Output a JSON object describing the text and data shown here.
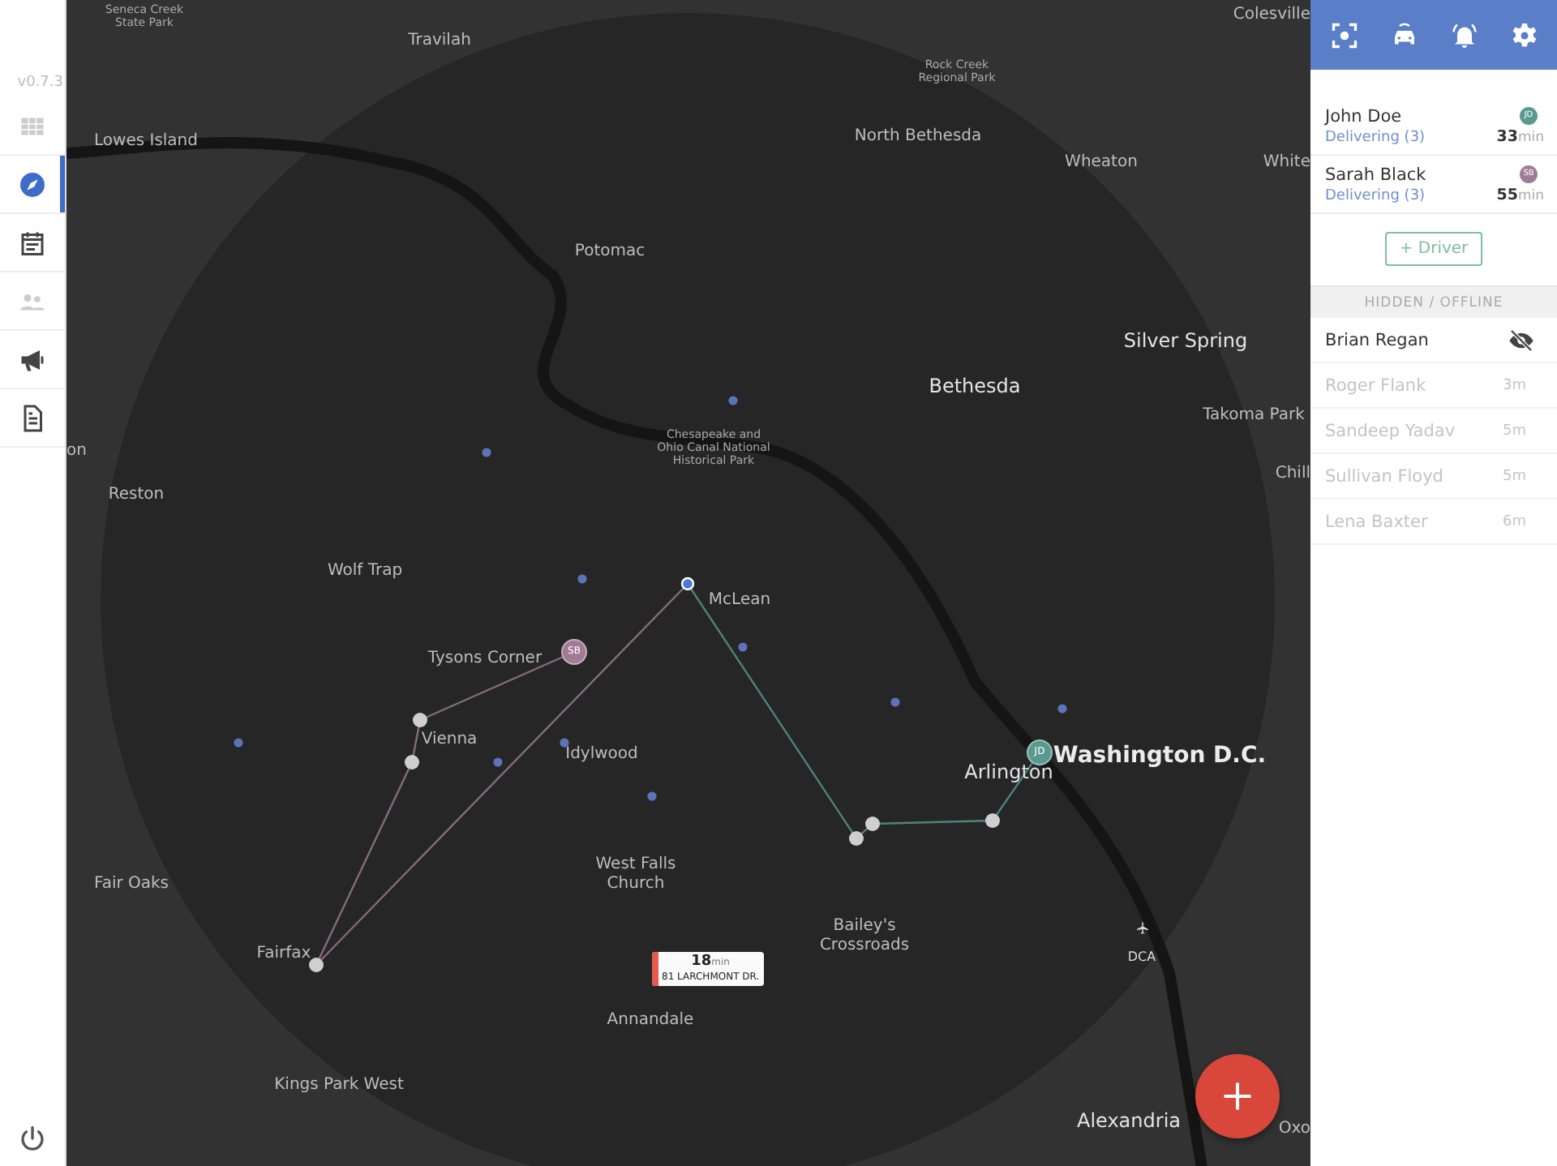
{
  "sidebar": {
    "version": "v0.7.3",
    "items": [
      {
        "selected": false,
        "disabled": true
      },
      {
        "selected": true,
        "disabled": false
      },
      {
        "selected": false,
        "disabled": false
      },
      {
        "selected": false,
        "disabled": true
      },
      {
        "selected": false,
        "disabled": false
      },
      {
        "selected": false,
        "disabled": false
      }
    ]
  },
  "map": {
    "labels": [
      {
        "text": "Seneca Creek\nState Park",
        "kind": "park"
      },
      {
        "text": "Travilah",
        "kind": "minor"
      },
      {
        "text": "Lowes Island",
        "kind": "minor"
      },
      {
        "text": "Potomac",
        "kind": "minor"
      },
      {
        "text": "on",
        "kind": "minor"
      },
      {
        "text": "Reston",
        "kind": "minor"
      },
      {
        "text": "Wolf Trap",
        "kind": "minor"
      },
      {
        "text": "Rock Creek\nRegional Park",
        "kind": "park"
      },
      {
        "text": "North Bethesda",
        "kind": "minor"
      },
      {
        "text": "Wheaton",
        "kind": "minor"
      },
      {
        "text": "Colesville",
        "kind": "minor"
      },
      {
        "text": "White",
        "kind": "minor"
      },
      {
        "text": "Silver Spring",
        "kind": "major"
      },
      {
        "text": "Bethesda",
        "kind": "major"
      },
      {
        "text": "Takoma Park",
        "kind": "minor"
      },
      {
        "text": "Chill",
        "kind": "minor"
      },
      {
        "text": "Chesapeake and\nOhio Canal National\nHistorical Park",
        "kind": "park"
      },
      {
        "text": "McLean",
        "kind": "minor"
      },
      {
        "text": "Tysons Corner",
        "kind": "minor"
      },
      {
        "text": "Vienna",
        "kind": "minor"
      },
      {
        "text": "Idylwood",
        "kind": "minor"
      },
      {
        "text": "Arlington",
        "kind": "major"
      },
      {
        "text": "Washington D.C.",
        "kind": "capital"
      },
      {
        "text": "Fair Oaks",
        "kind": "minor"
      },
      {
        "text": "West Falls\nChurch",
        "kind": "minor"
      },
      {
        "text": "Bailey's\nCrossroads",
        "kind": "minor"
      },
      {
        "text": "DCA",
        "kind": "airport"
      },
      {
        "text": "Fairfax",
        "kind": "minor"
      },
      {
        "text": "Annandale",
        "kind": "minor"
      },
      {
        "text": "Kings Park West",
        "kind": "minor"
      },
      {
        "text": "Alexandria",
        "kind": "major"
      },
      {
        "text": "Oxo",
        "kind": "minor"
      }
    ],
    "markers": [
      {
        "initials": "SB",
        "color": "#a07b95"
      },
      {
        "initials": "JD",
        "color": "#5a9a8e"
      }
    ],
    "order_tag": {
      "minutes": "18",
      "unit": "min",
      "address": "81 LARCHMONT DR."
    }
  },
  "drivers": [
    {
      "name": "John Doe",
      "status": "Delivering (3)",
      "initials": "JD",
      "color": "#5a9a8e",
      "minutes": "33",
      "unit": "min"
    },
    {
      "name": "Sarah Black",
      "status": "Delivering (3)",
      "initials": "SB",
      "color": "#a07b95",
      "minutes": "55",
      "unit": "min"
    }
  ],
  "add_driver_button": "+ Driver",
  "offline_section": {
    "title": "HIDDEN / OFFLINE",
    "drivers": [
      {
        "name": "Brian Regan",
        "kind": "hidden"
      },
      {
        "name": "Roger Flank",
        "kind": "offline",
        "time": "3m"
      },
      {
        "name": "Sandeep Yadav",
        "kind": "offline",
        "time": "5m"
      },
      {
        "name": "Sullivan Floyd",
        "kind": "offline",
        "time": "5m"
      },
      {
        "name": "Lena Baxter",
        "kind": "offline",
        "time": "6m"
      }
    ]
  }
}
